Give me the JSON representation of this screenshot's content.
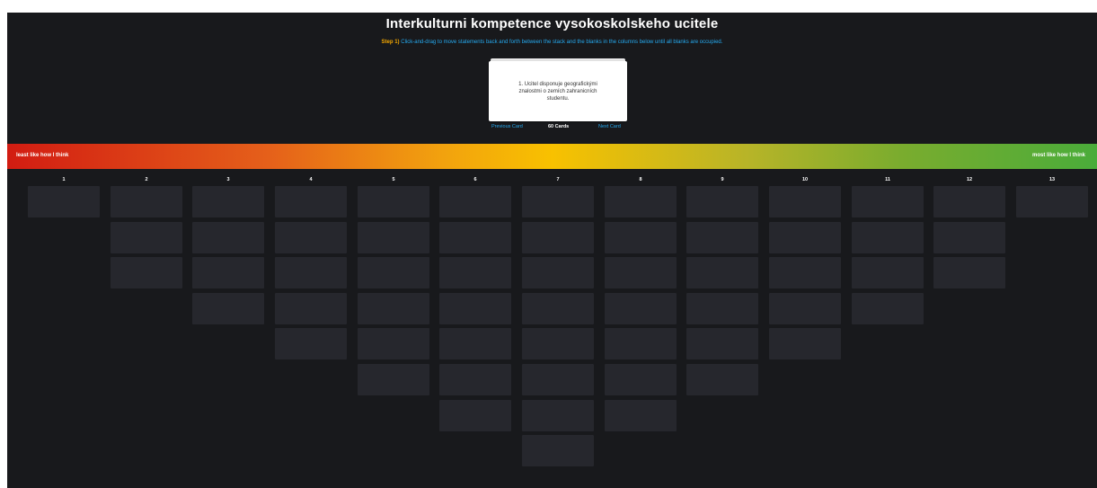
{
  "page": {
    "title": "Interkulturni kompetence vysokoskolskeho ucitele",
    "instruction_step": "Step 1)",
    "instruction_text": "Click-and-drag to move statements back and forth between the stack and the blanks in the columns below until all blanks are occupied."
  },
  "card": {
    "text": "1. Ucitel disponuje geografickými znalostmi o zemích zahranicních studentu.",
    "previous_label": "Previous Card",
    "count_label": "60 Cards",
    "next_label": "Next Card"
  },
  "scale": {
    "left_label": "least like how I think",
    "right_label": "most like how I think",
    "colors": [
      "#d21c12",
      "#f8c100",
      "#4aac3a"
    ]
  },
  "columns": [
    {
      "label": "1",
      "slots": 1
    },
    {
      "label": "2",
      "slots": 3
    },
    {
      "label": "3",
      "slots": 4
    },
    {
      "label": "4",
      "slots": 5
    },
    {
      "label": "5",
      "slots": 6
    },
    {
      "label": "6",
      "slots": 7
    },
    {
      "label": "7",
      "slots": 8
    },
    {
      "label": "8",
      "slots": 7
    },
    {
      "label": "9",
      "slots": 6
    },
    {
      "label": "10",
      "slots": 5
    },
    {
      "label": "11",
      "slots": 4
    },
    {
      "label": "12",
      "slots": 3
    },
    {
      "label": "13",
      "slots": 1
    }
  ]
}
